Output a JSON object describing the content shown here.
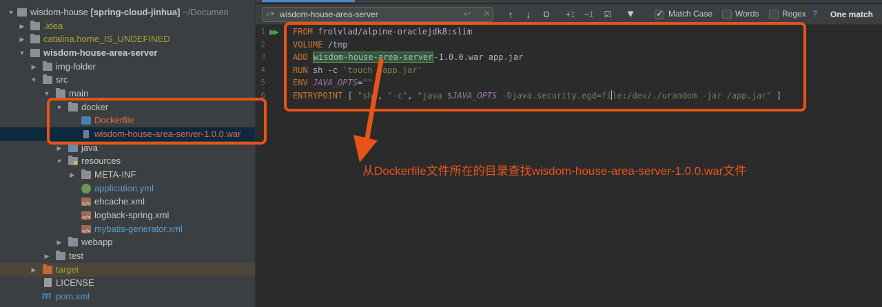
{
  "project_tree": {
    "root_name": "wisdom-house",
    "root_branch": "[spring-cloud-jinhua]",
    "root_path": "~/Documen",
    "items": [
      {
        "label": "wisdom-house",
        "name": "tree-item-wisdom-house"
      },
      {
        "label": ".idea",
        "name": "tree-item-idea"
      },
      {
        "label": "catalina.home_IS_UNDEFINED",
        "name": "tree-item-catalina-home"
      },
      {
        "label": "wisdom-house-area-server",
        "name": "tree-item-area-server"
      },
      {
        "label": "img-folder",
        "name": "tree-item-img-folder"
      },
      {
        "label": "src",
        "name": "tree-item-src"
      },
      {
        "label": "main",
        "name": "tree-item-main"
      },
      {
        "label": "docker",
        "name": "tree-item-docker"
      },
      {
        "label": "Dockerfile",
        "name": "tree-item-dockerfile"
      },
      {
        "label": "wisdom-house-area-server-1.0.0.war",
        "name": "tree-item-war-file"
      },
      {
        "label": "java",
        "name": "tree-item-java"
      },
      {
        "label": "resources",
        "name": "tree-item-resources"
      },
      {
        "label": "META-INF",
        "name": "tree-item-meta-inf"
      },
      {
        "label": "application.yml",
        "name": "tree-item-application-yml"
      },
      {
        "label": "ehcache.xml",
        "name": "tree-item-ehcache-xml"
      },
      {
        "label": "logback-spring.xml",
        "name": "tree-item-logback-xml"
      },
      {
        "label": "mybatis-generator.xml",
        "name": "tree-item-mybatis-xml"
      },
      {
        "label": "webapp",
        "name": "tree-item-webapp"
      },
      {
        "label": "test",
        "name": "tree-item-test"
      },
      {
        "label": "target",
        "name": "tree-item-target"
      },
      {
        "label": "LICENSE",
        "name": "tree-item-license"
      },
      {
        "label": "pom.xml",
        "name": "tree-item-pom"
      }
    ]
  },
  "find_bar": {
    "query": "wisdom-house-area-server",
    "match_case_label": "Match Case",
    "match_case_checked": true,
    "words_label": "Words",
    "words_checked": false,
    "regex_label": "Regex",
    "regex_help": "?",
    "status": "One match"
  },
  "editor": {
    "line_numbers": [
      "1",
      "2",
      "3",
      "4",
      "5",
      "6"
    ],
    "lines": {
      "l1_kw": "FROM",
      "l1_rest": " frolvlad/alpine-oraclejdk8:slim",
      "l2_kw": "VOLUME",
      "l2_rest": " /tmp",
      "l3_kw": "ADD",
      "l3_space": " ",
      "l3_hit": "wisdom-house-area-server",
      "l3_rest": "-1.0.0.war app.jar",
      "l4_kw": "RUN",
      "l4_mid": " sh -c ",
      "l4_str": "'touch /app.jar'",
      "l5_kw": "ENV",
      "l5_space": " ",
      "l5_var": "JAVA_OPTS",
      "l5_eq": "=",
      "l5_str": "\"\"",
      "l6_kw": "ENTRYPOINT",
      "l6_a": " [ ",
      "l6_s1": "\"sh\"",
      "l6_c1": ", ",
      "l6_s2": "\"-c\"",
      "l6_c2": ", ",
      "l6_s3a": "\"java $",
      "l6_var": "JAVA_OPTS",
      "l6_s3b": " -Djava.security.egd=fi",
      "l6_s3c": "le:/dev/./urandom -jar /app.jar\"",
      "l6_end": " ]"
    }
  },
  "annotation": {
    "text": "从Dockerfile文件所在的目录查找wisdom-house-area-server-1.0.0.war文件",
    "color": "#e8531a"
  },
  "icons": {
    "search": "search-icon",
    "prev": "arrow-up-icon",
    "next": "arrow-down-icon",
    "filter": "filter-icon"
  }
}
